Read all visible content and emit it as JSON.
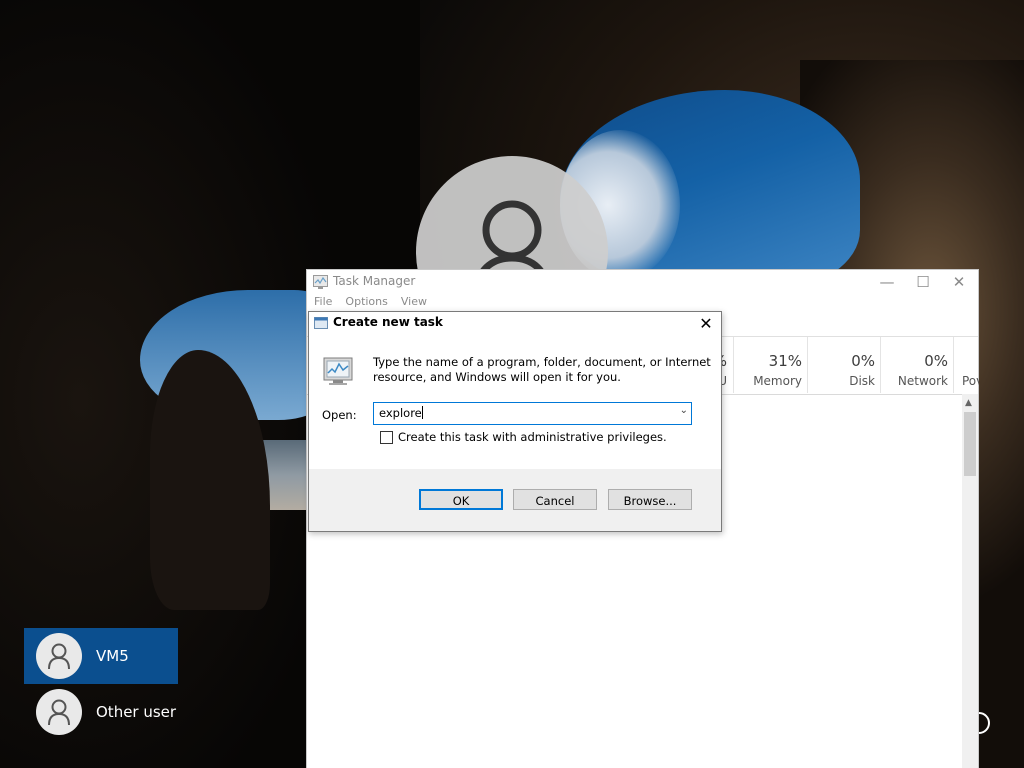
{
  "lock_screen": {
    "users": [
      {
        "name": "VM5",
        "selected": true
      },
      {
        "name": "Other user",
        "selected": false
      }
    ]
  },
  "task_manager": {
    "title": "Task Manager",
    "menu": [
      "File",
      "Options",
      "View"
    ],
    "columns": [
      {
        "pct": "%",
        "label": "U"
      },
      {
        "pct": "31%",
        "label": "Memory"
      },
      {
        "pct": "0%",
        "label": "Disk"
      },
      {
        "pct": "0%",
        "label": "Network"
      },
      {
        "pct": "",
        "label": "Pov"
      }
    ]
  },
  "dialog": {
    "title": "Create new task",
    "description": "Type the name of a program, folder, document, or Internet resource, and Windows will open it for you.",
    "open_label": "Open:",
    "open_value": "explore",
    "admin_checkbox_label": "Create this task with administrative privileges.",
    "admin_checked": false,
    "ok_label": "OK",
    "cancel_label": "Cancel",
    "browse_label": "Browse..."
  },
  "colors": {
    "selected_user_bg": "#0b4f8f",
    "focus_accent": "#0078d7"
  }
}
